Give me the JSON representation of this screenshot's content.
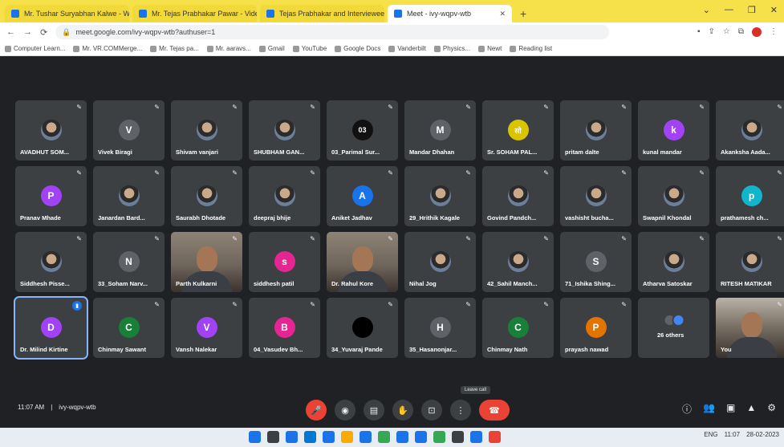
{
  "browser": {
    "tabs": [
      {
        "label": "Mr. Tushar Suryabhan Kalwe - Web...",
        "active": false
      },
      {
        "label": "Mr. Tejas Prabhakar Pawar - Vide...",
        "active": false
      },
      {
        "label": "Tejas Prabhakar and Interviewee",
        "active": false
      },
      {
        "label": "Meet - ivy-wqpv-wtb",
        "active": true
      }
    ],
    "new_tab": "+",
    "window_controls": [
      "⌄",
      "—",
      "❐",
      "✕"
    ],
    "url": "meet.google.com/ivy-wqpv-wtb?authuser=1",
    "bookmarks": [
      "Computer Learn...",
      "Mr. VR.COMMerge...",
      "Mr. Tejas pa...",
      "Mr. aaravs...",
      "Gmail",
      "YouTube",
      "Google Docs",
      "Vanderbilt",
      "Physics...",
      "Newt",
      "Reading list"
    ]
  },
  "meet": {
    "tiles": [
      {
        "name": "AVADHUT SOM...",
        "type": "photo",
        "color": "#6b7f99"
      },
      {
        "name": "Vivek Biragi",
        "type": "letter",
        "letter": "V",
        "color": "#5f6368"
      },
      {
        "name": "Shivam vanjari",
        "type": "photo",
        "color": "#6b7f99"
      },
      {
        "name": "SHUBHAM GAN...",
        "type": "photo",
        "color": "#6b7f99"
      },
      {
        "name": "03_Parimal Sur...",
        "type": "letter",
        "letter": "03",
        "color": "#111111"
      },
      {
        "name": "Mandar Dhahan",
        "type": "letter",
        "letter": "M",
        "color": "#5f6368"
      },
      {
        "name": "Sr. SOHAM PAL...",
        "type": "letter",
        "letter": "सो",
        "color": "#d9c400"
      },
      {
        "name": "pritam dalte",
        "type": "photo",
        "color": "#6b7f99"
      },
      {
        "name": "kunal mandar",
        "type": "letter",
        "letter": "k",
        "color": "#a142f4"
      },
      {
        "name": "Akanksha Aada...",
        "type": "photo",
        "color": "#6b7f99"
      },
      {
        "name": "Pranav Mhade",
        "type": "letter",
        "letter": "P",
        "color": "#a142f4"
      },
      {
        "name": "Janardan Bard...",
        "type": "photo",
        "color": "#6b7f99"
      },
      {
        "name": "Saurabh Dhotade",
        "type": "photo",
        "color": "#6b7f99"
      },
      {
        "name": "deepraj bhije",
        "type": "photo",
        "color": "#6b7f99"
      },
      {
        "name": "Aniket Jadhav",
        "type": "letter",
        "letter": "A",
        "color": "#1a73e8"
      },
      {
        "name": "29_Hrithik Kagale",
        "type": "photo",
        "color": "#6b7f99"
      },
      {
        "name": "Govind Pandch...",
        "type": "photo",
        "color": "#6b7f99"
      },
      {
        "name": "vashisht bucha...",
        "type": "photo",
        "color": "#6b7f99"
      },
      {
        "name": "Swapnil Khondal",
        "type": "photo",
        "color": "#6b7f99"
      },
      {
        "name": "prathamesh ch...",
        "type": "letter",
        "letter": "p",
        "color": "#12b5cb"
      },
      {
        "name": "Siddhesh Pisse...",
        "type": "photo",
        "color": "#6b7f99"
      },
      {
        "name": "33_Soham Narv...",
        "type": "letter",
        "letter": "N",
        "color": "#5f6368"
      },
      {
        "name": "Parth Kulkarni",
        "type": "video",
        "color": "#8d8275"
      },
      {
        "name": "siddhesh patil",
        "type": "letter",
        "letter": "s",
        "color": "#e52592"
      },
      {
        "name": "Dr. Rahul Kore",
        "type": "video",
        "color": "#8d8275"
      },
      {
        "name": "Nihal Jog",
        "type": "photo",
        "color": "#6b7f99"
      },
      {
        "name": "42_Sahil Manch...",
        "type": "photo",
        "color": "#111111"
      },
      {
        "name": "71_Ishika Shing...",
        "type": "letter",
        "letter": "S",
        "color": "#5f6368"
      },
      {
        "name": "Atharva Satoskar",
        "type": "photo",
        "color": "#6b7f99"
      },
      {
        "name": "RITESH MATIKAR",
        "type": "photo",
        "color": "#6b7f99"
      },
      {
        "name": "Dr. Milind Kirtine",
        "type": "letter",
        "letter": "D",
        "color": "#a142f4",
        "speaking": true
      },
      {
        "name": "Chinmay Sawant",
        "type": "letter",
        "letter": "C",
        "color": "#188038"
      },
      {
        "name": "Vansh Nalekar",
        "type": "letter",
        "letter": "V",
        "color": "#a142f4"
      },
      {
        "name": "04_Vasudev Bh...",
        "type": "letter",
        "letter": "B",
        "color": "#e52592"
      },
      {
        "name": "34_Yuvaraj Pande",
        "type": "letter",
        "letter": "",
        "color": "#000000"
      },
      {
        "name": "35_Hasanonjar...",
        "type": "letter",
        "letter": "H",
        "color": "#5f6368"
      },
      {
        "name": "Chinmay Nath",
        "type": "letter",
        "letter": "C",
        "color": "#188038"
      },
      {
        "name": "prayash nawad",
        "type": "letter",
        "letter": "P",
        "color": "#e37400"
      },
      {
        "name": "26 others",
        "type": "others",
        "color": "#4285f4"
      },
      {
        "name": "You",
        "type": "video",
        "color": "#b9b2a6"
      }
    ],
    "meeting_time": "11:07 AM",
    "meeting_code": "ivy-wqpv-wtb",
    "leave_tooltip": "Leave call",
    "controls": [
      {
        "name": "mic-off-button",
        "glyph": "🎤",
        "red": true
      },
      {
        "name": "camera-button",
        "glyph": "◉",
        "red": false
      },
      {
        "name": "captions-button",
        "glyph": "▤",
        "red": false
      },
      {
        "name": "raise-hand-button",
        "glyph": "✋",
        "red": false
      },
      {
        "name": "present-button",
        "glyph": "⊡",
        "red": false
      },
      {
        "name": "more-options-button",
        "glyph": "⋮",
        "red": false
      }
    ],
    "end_call_glyph": "☎",
    "right_controls": [
      {
        "name": "info-icon",
        "glyph": "ⓘ"
      },
      {
        "name": "people-icon",
        "glyph": "👥"
      },
      {
        "name": "chat-icon",
        "glyph": "▣"
      },
      {
        "name": "activities-icon",
        "glyph": "▲"
      },
      {
        "name": "host-controls-icon",
        "glyph": "⚙"
      }
    ]
  },
  "taskbar": {
    "icons": [
      "#1a73e8",
      "#3c4043",
      "#1a73e8",
      "#0078d4",
      "#1a73e8",
      "#f9ab00",
      "#1a73e8",
      "#34a853",
      "#1a73e8",
      "#1a73e8",
      "#34a853",
      "#3c4043",
      "#1a73e8",
      "#ea4335"
    ],
    "tray_text": "ENG",
    "time": "11:07",
    "date": "28-02-2023"
  }
}
